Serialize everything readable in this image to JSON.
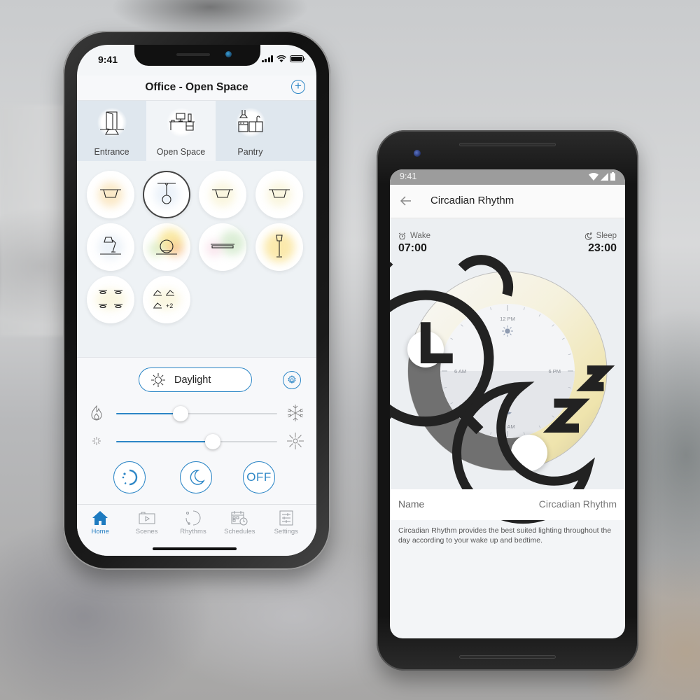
{
  "iphone": {
    "status": {
      "time": "9:41"
    },
    "title": "Office - Open Space",
    "add_icon": "plus-circle-icon",
    "rooms": [
      {
        "label": "Entrance",
        "icon": "door-icon",
        "active": false
      },
      {
        "label": "Open Space",
        "icon": "desk-icon",
        "active": true
      },
      {
        "label": "Pantry",
        "icon": "kitchen-icon",
        "active": false
      }
    ],
    "lights": [
      {
        "icon": "ceiling-light-icon",
        "glow": "#f7d79a",
        "selected": false
      },
      {
        "icon": "pendant-light-icon",
        "glow": "#dce8f5",
        "selected": true
      },
      {
        "icon": "ceiling-light-icon",
        "glow": "#f6efc6",
        "selected": false
      },
      {
        "icon": "ceiling-light-icon",
        "glow": "#f6efc6",
        "selected": false
      },
      {
        "icon": "desk-lamp-icon",
        "glow": "#dde8f3",
        "selected": false
      },
      {
        "icon": "globe-lamp-icon",
        "glow": "#f5d75a",
        "selected": false
      },
      {
        "icon": "linear-light-icon",
        "glow": "#bfe0b5",
        "selected": false
      },
      {
        "icon": "floor-lamp-icon",
        "glow": "#f8d86a",
        "selected": false
      },
      {
        "icon": "downlights-group-icon",
        "glow": "#f6f0c8",
        "selected": false
      },
      {
        "icon": "spotlights-group-icon",
        "glow": "#f6f0c8",
        "selected": false,
        "badge": "+2"
      }
    ],
    "scene": {
      "label": "Daylight",
      "icon": "sun-icon"
    },
    "settings_icon": "gear-icon",
    "sliders": {
      "color_temperature": {
        "left_icon": "flame-icon",
        "right_icon": "snowflake-icon",
        "value": 0.4
      },
      "brightness": {
        "left_icon": "dim-sun-icon",
        "right_icon": "bright-sun-icon",
        "value": 0.6
      }
    },
    "actions": [
      {
        "name": "rhythm-button",
        "icon": "rhythm-icon"
      },
      {
        "name": "night-button",
        "icon": "moon-icon"
      },
      {
        "name": "off-button",
        "label": "OFF"
      }
    ],
    "tabs": [
      {
        "label": "Home",
        "icon": "home-icon",
        "active": true
      },
      {
        "label": "Scenes",
        "icon": "scenes-icon",
        "active": false
      },
      {
        "label": "Rhythms",
        "icon": "rhythms-icon",
        "active": false
      },
      {
        "label": "Schedules",
        "icon": "schedules-icon",
        "active": false
      },
      {
        "label": "Settings",
        "icon": "settings-sliders-icon",
        "active": false
      }
    ]
  },
  "android": {
    "status": {
      "time": "9:41"
    },
    "title": "Circadian Rhythm",
    "wake": {
      "label": "Wake",
      "time": "07:00"
    },
    "sleep": {
      "label": "Sleep",
      "time": "23:00"
    },
    "dial": {
      "labels": {
        "top": "12 PM",
        "right": "6 PM",
        "bottom": "12 AM",
        "left": "6 AM"
      },
      "wake_hour": 7,
      "sleep_hour": 23
    },
    "name_row": {
      "label": "Name",
      "value": "Circadian Rhythm"
    },
    "description": "Circadian Rhythm provides the best suited lighting throughout the day according to your wake up and bedtime."
  },
  "colors": {
    "accent": "#2c86c6",
    "night_arc": "#6f6f6f",
    "day_arc_warm": "#f2e6b2"
  }
}
